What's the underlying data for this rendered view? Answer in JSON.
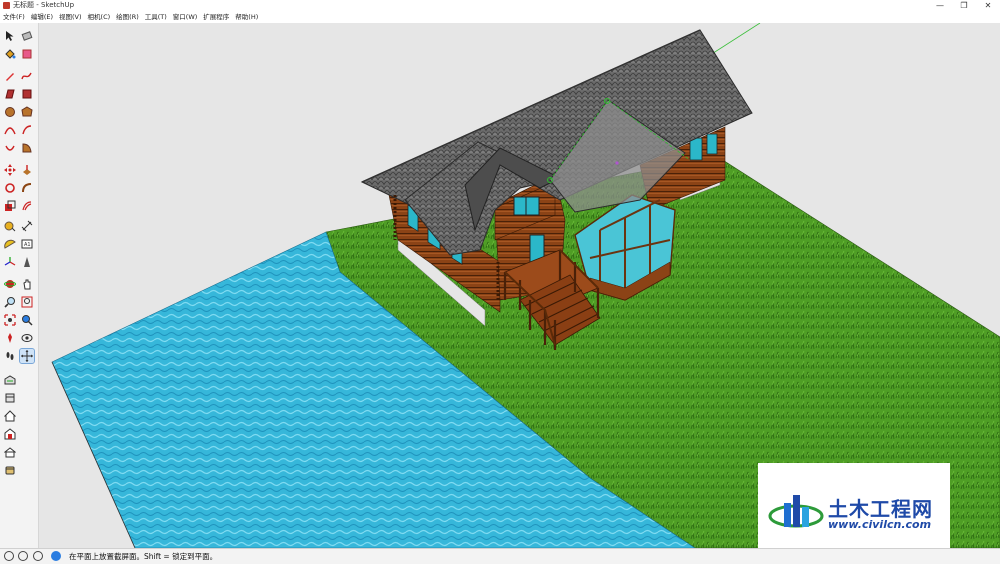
{
  "window": {
    "title": "无标题 - SketchUp",
    "min": "—",
    "max": "❐",
    "close": "✕"
  },
  "menu": [
    "文件(F)",
    "编辑(E)",
    "视图(V)",
    "相机(C)",
    "绘图(R)",
    "工具(T)",
    "窗口(W)",
    "扩展程序",
    "帮助(H)"
  ],
  "status": {
    "text": "在平面上放置截屏面。Shift = 锁定到平面。"
  },
  "watermark": {
    "title": "土木工程网",
    "url": "www.civilcn.com"
  },
  "colors": {
    "water": "#35b6d9",
    "grass": "#4e9f24",
    "roof": "#6e6e6e",
    "wall": "#8b4514",
    "sky": "#e6e6e6"
  },
  "tools": [
    "select-icon",
    "eraser-icon",
    "paint-bucket-icon",
    "lasso-icon",
    "pencil-icon",
    "freehand-icon",
    "rectangle-icon",
    "rotated-rectangle-icon",
    "circle-icon",
    "polygon-icon",
    "arc-icon",
    "pie-icon",
    "move-icon",
    "push-pull-icon",
    "rotate-icon",
    "follow-me-icon",
    "scale-icon",
    "offset-icon",
    "tape-measure-icon",
    "dimension-icon",
    "protractor-icon",
    "text-icon",
    "axes-icon",
    "3d-text-icon",
    "orbit-icon",
    "pan-icon",
    "zoom-icon",
    "zoom-window-icon",
    "zoom-extents-icon",
    "position-camera-icon",
    "look-around-icon",
    "walk-icon",
    "section-plane-icon",
    "warehouse-icon",
    "components-icon",
    "home-icon",
    "share-icon",
    "outliner-icon",
    "layers-icon"
  ]
}
